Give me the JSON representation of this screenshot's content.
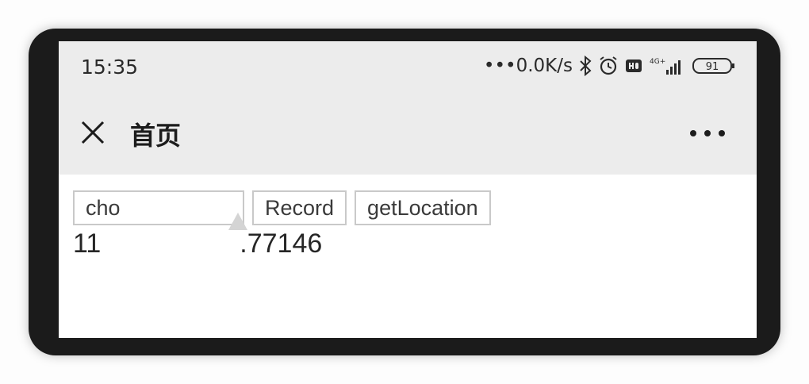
{
  "status_bar": {
    "time": "15:35",
    "net_speed": "•••0.0K/s",
    "network_label": "4G+",
    "battery": "91",
    "icons": [
      "bluetooth-icon",
      "alarm-icon",
      "hd-icon",
      "signal-icon",
      "battery-icon"
    ]
  },
  "nav": {
    "title": "首页",
    "close_icon": "close-icon",
    "more_icon": "more-icon"
  },
  "main": {
    "buttons": [
      {
        "label": "cho"
      },
      {
        "label": "Record"
      },
      {
        "label": "getLocation"
      }
    ],
    "location_prefix": "11",
    "location_suffix": ".77146"
  },
  "colors": {
    "frame": "#1b1b1b",
    "bar_bg": "#ececec",
    "button_border": "#c9c9c9",
    "text": "#262626"
  }
}
